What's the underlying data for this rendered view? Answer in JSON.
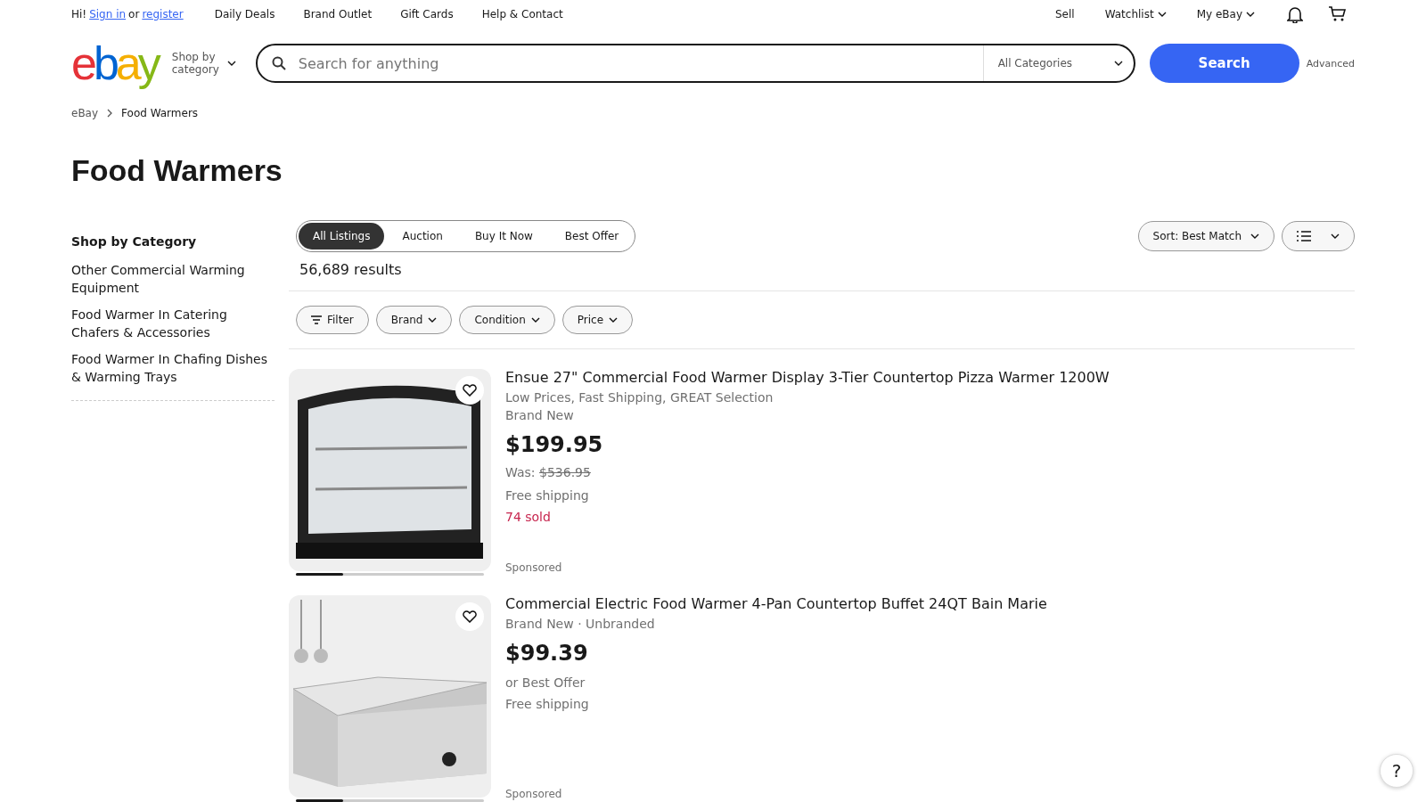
{
  "top_bar": {
    "greeting": "Hi!",
    "sign_in": "Sign in",
    "or": "or",
    "register": "register",
    "links": [
      "Daily Deals",
      "Brand Outlet",
      "Gift Cards",
      "Help & Contact"
    ],
    "right": [
      {
        "label": "Sell",
        "dropdown": false
      },
      {
        "label": "Watchlist",
        "dropdown": true
      },
      {
        "label": "My eBay",
        "dropdown": true
      }
    ]
  },
  "header": {
    "logo": "ebay",
    "shop_by_category": "Shop by category",
    "search": {
      "placeholder": "Search for anything",
      "category": "All Categories"
    },
    "search_button": "Search",
    "advanced": "Advanced"
  },
  "breadcrumb": [
    "eBay",
    "Food Warmers"
  ],
  "page_title": "Food Warmers",
  "sidebar": {
    "heading": "Shop by Category",
    "items": [
      "Other Commercial Warming Equipment",
      "Food Warmer In Catering Chafers & Accessories",
      "Food Warmer In Chafing Dishes & Warming Trays"
    ]
  },
  "tabs": [
    {
      "label": "All Listings",
      "selected": true
    },
    {
      "label": "Auction",
      "selected": false
    },
    {
      "label": "Buy It Now",
      "selected": false
    },
    {
      "label": "Best Offer",
      "selected": false
    }
  ],
  "sort": "Sort: Best Match",
  "results": "56,689 results",
  "filters": [
    {
      "label": "Filter",
      "kind": "filter"
    },
    {
      "label": "Brand",
      "kind": "dropdown"
    },
    {
      "label": "Condition",
      "kind": "dropdown"
    },
    {
      "label": "Price",
      "kind": "dropdown"
    }
  ],
  "listings": [
    {
      "title": "Ensue 27\" Commercial Food Warmer Display 3-Tier Countertop Pizza Warmer 1200W",
      "kind": "display",
      "image_progress": {
        "level": 0.25
      },
      "lines": [
        {
          "kind": "subtitle",
          "text": "Low Prices, Fast Shipping, GREAT Selection"
        },
        {
          "kind": "condition",
          "text": "Brand New"
        },
        {
          "kind": "price",
          "text": "$199.95"
        },
        {
          "kind": "was",
          "label": "Was:",
          "text": "$536.95"
        },
        {
          "kind": "shipping",
          "text": "Free shipping"
        },
        {
          "kind": "sold",
          "text": "74 sold"
        }
      ],
      "sponsored": "Sponsored"
    },
    {
      "title": "Commercial Electric Food Warmer 4-Pan Countertop Buffet 24QT Bain Marie",
      "kind": "bain",
      "image_progress": {
        "level": 0.25
      },
      "lines": [
        {
          "kind": "condition",
          "text": "Brand New · Unbranded"
        },
        {
          "kind": "price",
          "text": "$99.39"
        },
        {
          "kind": "offer",
          "text": "or Best Offer"
        },
        {
          "kind": "shipping",
          "text": "Free shipping"
        }
      ],
      "sponsored": "Sponsored"
    }
  ],
  "help_button": "?"
}
